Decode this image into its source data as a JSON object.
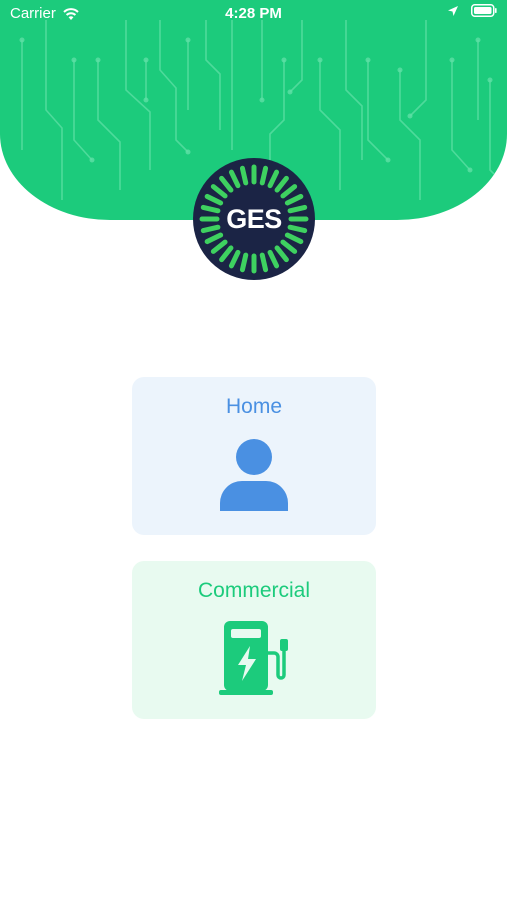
{
  "status_bar": {
    "carrier": "Carrier",
    "time": "4:28 PM",
    "icons": [
      "wifi-icon",
      "location-arrow-icon",
      "battery-icon"
    ]
  },
  "logo": {
    "text": "GES"
  },
  "options": [
    {
      "label": "Home",
      "icon": "person-icon"
    },
    {
      "label": "Commercial",
      "icon": "ev-charger-icon"
    }
  ],
  "colors": {
    "header_green": "#1ccb7c",
    "logo_navy": "#1b2445",
    "home_blue": "#4a90e2",
    "home_card_bg": "#ecf4fc",
    "commercial_green": "#1ccb7c",
    "commercial_card_bg": "#e8faf0"
  }
}
